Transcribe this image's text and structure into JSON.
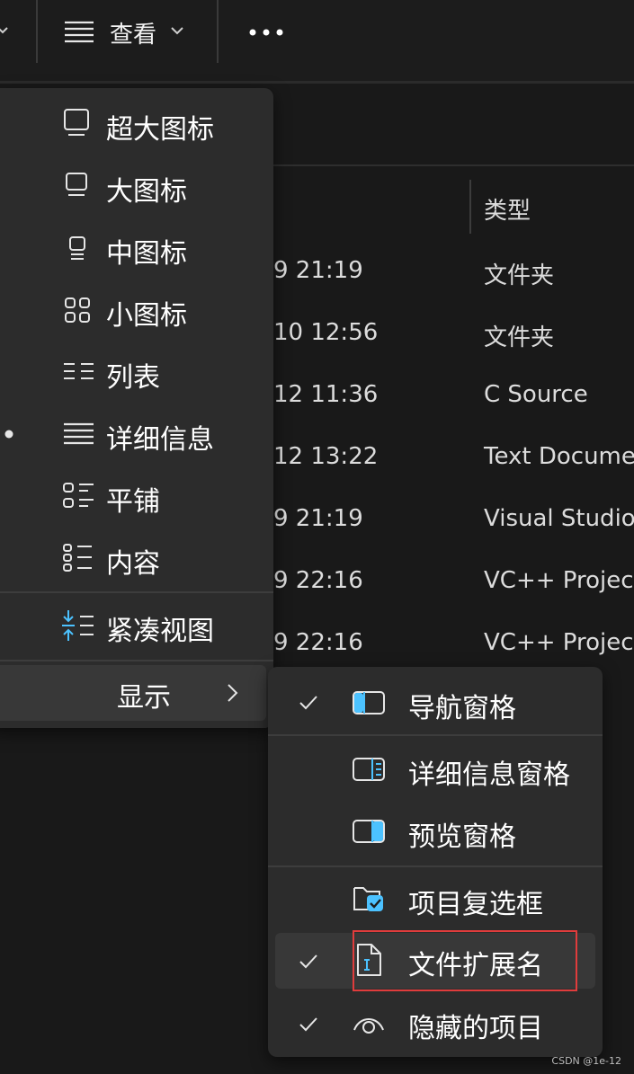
{
  "toolbar": {
    "view_label": "查看",
    "more_label": "•••"
  },
  "file_list": {
    "type_header": "类型",
    "rows": [
      {
        "modified": "9 21:19",
        "type": "文件夹"
      },
      {
        "modified": "10 12:56",
        "type": "文件夹"
      },
      {
        "modified": "12 11:36",
        "type": "C Source"
      },
      {
        "modified": "12 13:22",
        "type": "Text Docume"
      },
      {
        "modified": "9 21:19",
        "type": "Visual Studio"
      },
      {
        "modified": "9 22:16",
        "type": "VC++ Project"
      },
      {
        "modified": "9 22:16",
        "type": "VC++ Project"
      }
    ]
  },
  "view_menu": {
    "items": [
      {
        "label": "超大图标",
        "icon": "extra-large-icons-icon"
      },
      {
        "label": "大图标",
        "icon": "large-icons-icon"
      },
      {
        "label": "中图标",
        "icon": "medium-icons-icon"
      },
      {
        "label": "小图标",
        "icon": "small-icons-icon"
      },
      {
        "label": "列表",
        "icon": "list-icon"
      },
      {
        "label": "详细信息",
        "icon": "details-icon",
        "selected": true
      },
      {
        "label": "平铺",
        "icon": "tiles-icon"
      },
      {
        "label": "内容",
        "icon": "content-icon"
      }
    ],
    "compact_label": "紧凑视图",
    "show_label": "显示"
  },
  "show_submenu": {
    "items": [
      {
        "label": "导航窗格",
        "checked": true,
        "icon": "navigation-pane-icon"
      },
      {
        "label": "详细信息窗格",
        "checked": false,
        "icon": "details-pane-icon"
      },
      {
        "label": "预览窗格",
        "checked": false,
        "icon": "preview-pane-icon"
      },
      {
        "label": "项目复选框",
        "checked": false,
        "icon": "item-checkbox-icon"
      },
      {
        "label": "文件扩展名",
        "checked": true,
        "icon": "file-extension-icon",
        "highlighted": true
      },
      {
        "label": "隐藏的项目",
        "checked": true,
        "icon": "hidden-items-icon"
      }
    ]
  },
  "watermark": "CSDN @1e-12",
  "colors": {
    "accent": "#4cc2ff",
    "annotation_red": "#e03c3c",
    "background": "#191919",
    "menu": "#2c2c2c"
  }
}
